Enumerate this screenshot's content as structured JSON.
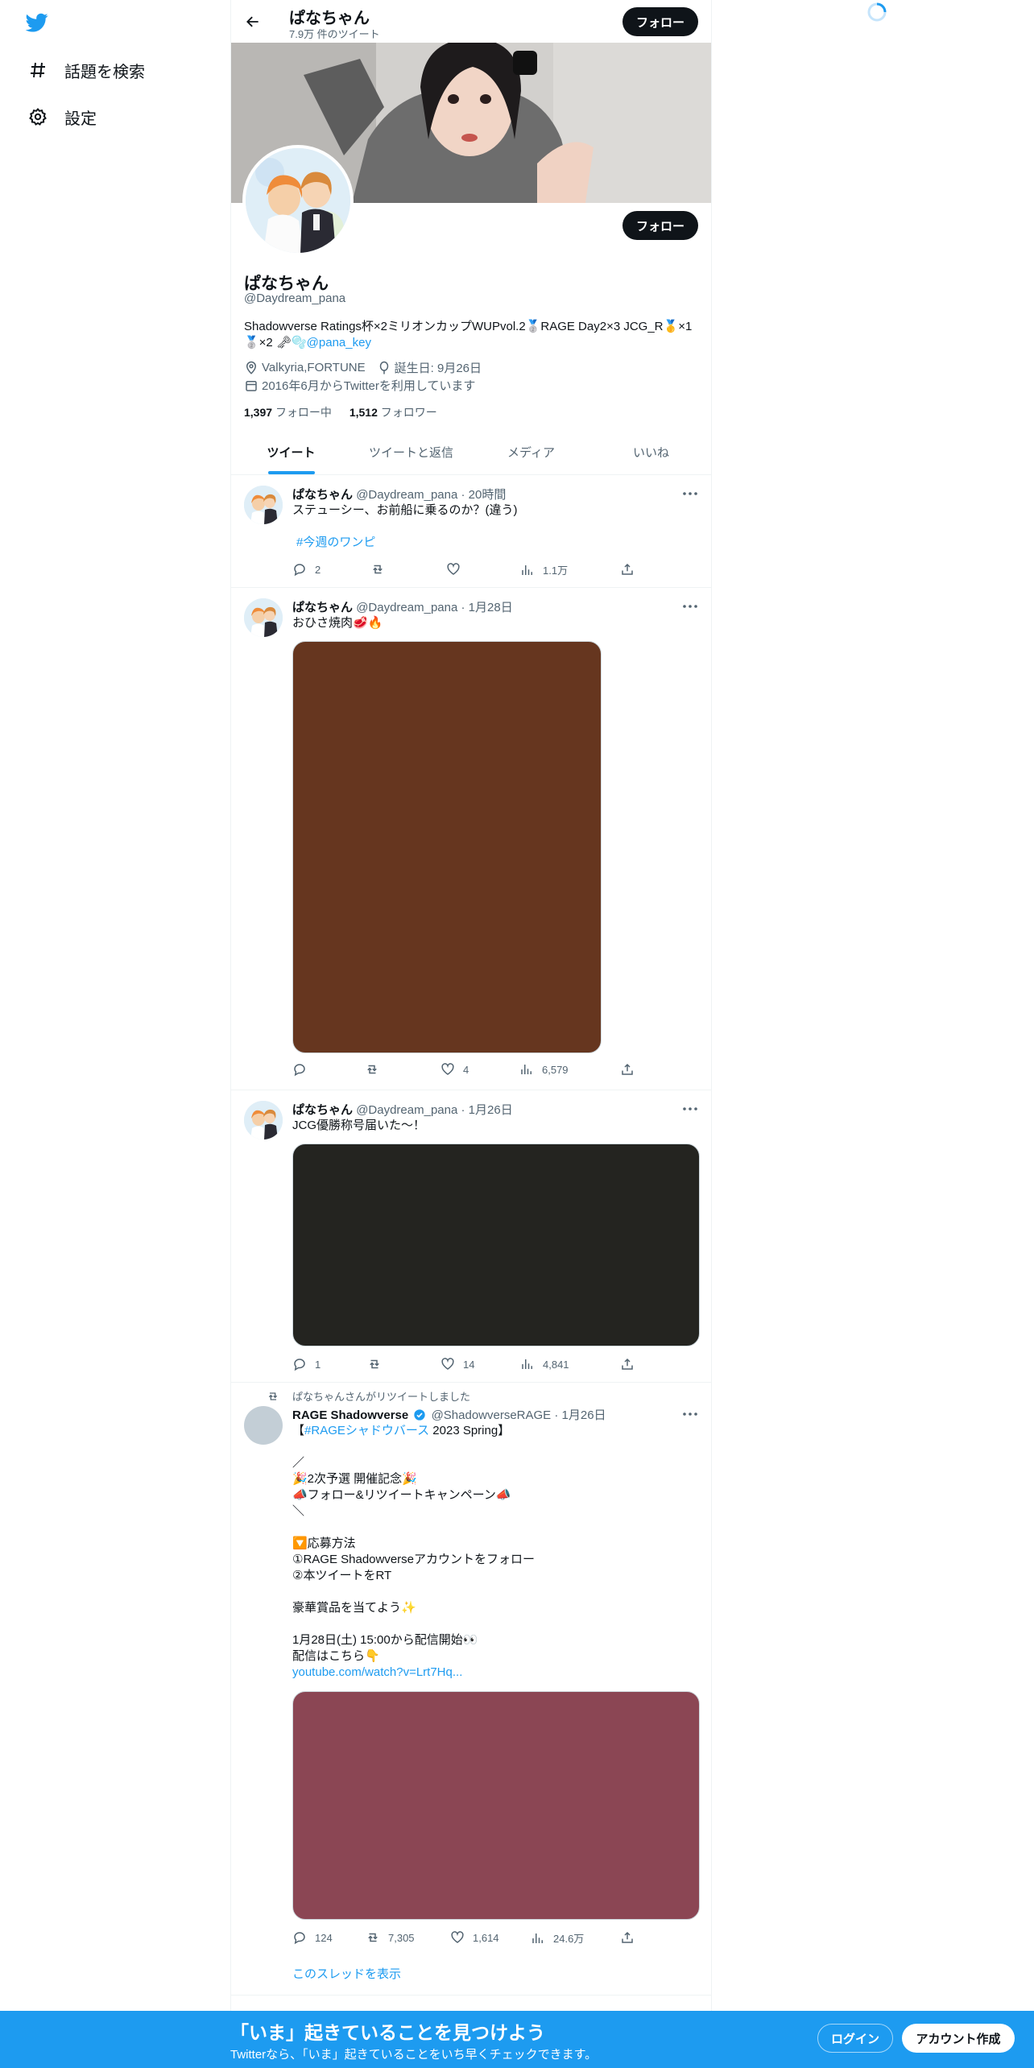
{
  "nav": {
    "explore_label": "話題を検索",
    "settings_label": "設定"
  },
  "header": {
    "name": "ぱなちゃん",
    "tweet_count": "7.9万 件のツイート",
    "follow_label": "フォロー"
  },
  "profile": {
    "name": "ぱなちゃん",
    "handle": "@Daydream_pana",
    "bio_line1": "Shadowverse Ratings杯×2ミリオンカップWUPvol.2🥈RAGE Day2×3 JCG_R🥇×1",
    "bio_line2_prefix": "🥈×2 🗝🫧",
    "bio_link": "@pana_key",
    "location": "Valkyria,FORTUNE",
    "birthday": "誕生日: 9月26日",
    "joined": "2016年6月からTwitterを利用しています",
    "following_count": "1,397",
    "following_label": "フォロー中",
    "followers_count": "1,512",
    "followers_label": "フォロワー",
    "follow_label": "フォロー"
  },
  "tabs": [
    "ツイート",
    "ツイートと返信",
    "メディア",
    "いいね"
  ],
  "tweets": [
    {
      "name": "ぱなちゃん",
      "handle": "@Daydream_pana",
      "time": "20時間",
      "text": "ステューシー、お前船に乗るのか？(違う)",
      "hashtag": "#今週のワンピ",
      "replies": "2",
      "retweets": "",
      "likes": "",
      "views": "1.1万",
      "media_color": ""
    },
    {
      "name": "ぱなちゃん",
      "handle": "@Daydream_pana",
      "time": "1月28日",
      "text": "おひさ焼肉🥩🔥",
      "replies": "",
      "retweets": "",
      "likes": "4",
      "views": "6,579",
      "media_color": "#66361f"
    },
    {
      "name": "ぱなちゃん",
      "handle": "@Daydream_pana",
      "time": "1月26日",
      "text": "JCG優勝称号届いた〜！",
      "replies": "1",
      "retweets": "",
      "likes": "14",
      "views": "4,841",
      "media_color": "#242420"
    },
    {
      "retweet_label": "ぱなちゃんさんがリツイートしました",
      "name": "RAGE Shadowverse",
      "handle": "@ShadowverseRAGE",
      "time": "1月26日",
      "text_hashtag": "#RAGEシャドウバース",
      "text_open": "【",
      "text_after_hashtag": " 2023 Spring】",
      "text_body": "／\n🎉2次予選 開催記念🎉\n📣フォロー&リツイートキャンペーン📣\n＼\n\n🔽応募方法\n①RAGE Shadowverseアカウントをフォロー\n②本ツイートをRT\n\n豪華賞品を当てよう✨\n\n1月28日(土) 15:00から配信開始👀\n配信はこちら👇",
      "link": "youtube.com/watch?v=Lrt7Hq...",
      "replies": "124",
      "retweets": "7,305",
      "likes": "1,614",
      "views": "24.6万",
      "media_color": "#8b4654",
      "thread_label": "このスレッドを表示"
    }
  ],
  "bottom_bar": {
    "title": "「いま」起きていることを見つけよう",
    "subtitle": "Twitterなら、「いま」起きていることをいち早くチェックできます。",
    "login_label": "ログイン",
    "signup_label": "アカウント作成"
  },
  "colors": {
    "accent": "#1d9bf0",
    "text": "#0f1419",
    "secondary": "#536471"
  }
}
